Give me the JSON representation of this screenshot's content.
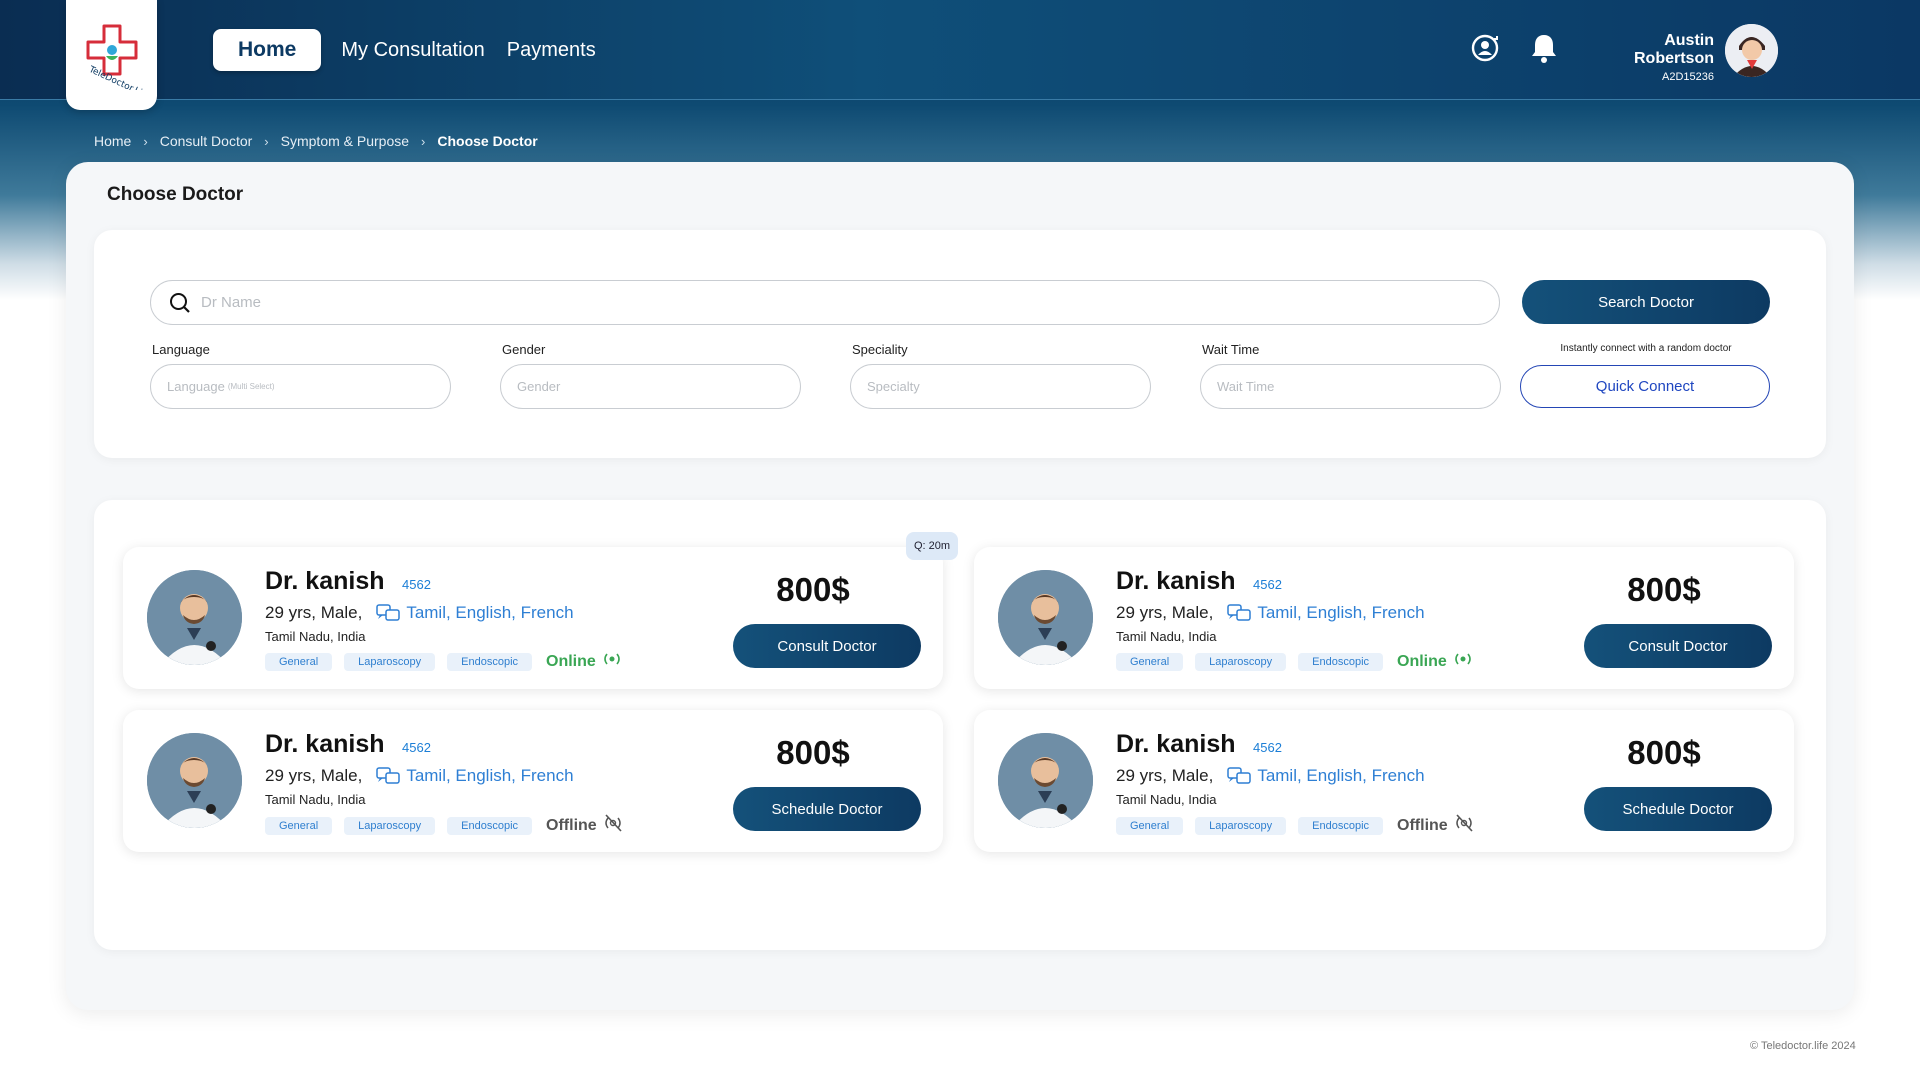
{
  "brand": {
    "logo_text": "TeleDoctor.Life"
  },
  "nav": {
    "home": "Home",
    "consultation": "My Consultation",
    "payments": "Payments"
  },
  "user": {
    "name": "Austin Robertson",
    "id": "A2D15236"
  },
  "icons": [
    "user-sync-icon",
    "bell-icon"
  ],
  "breadcrumb": [
    "Home",
    "Consult Doctor",
    "Symptom & Purpose",
    "Choose Doctor"
  ],
  "page": {
    "title": "Choose Doctor"
  },
  "search": {
    "placeholder": "Dr Name",
    "button": "Search Doctor"
  },
  "filters": {
    "language": {
      "label": "Language",
      "placeholder": "Language",
      "sub": "(Multi Select)"
    },
    "gender": {
      "label": "Gender",
      "placeholder": "Gender"
    },
    "speciality": {
      "label": "Speciality",
      "placeholder": "Specialty"
    },
    "wait_time": {
      "label": "Wait Time",
      "placeholder": "Wait Time"
    }
  },
  "quick_connect": {
    "note": "Instantly connect with a random doctor",
    "button": "Quick Connect"
  },
  "queue_badge": "Q: 20m",
  "doctors": [
    {
      "name": "Dr. kanish",
      "code": "4562",
      "meta": "29 yrs, Male,",
      "languages": "Tamil, English, French",
      "location": "Tamil Nadu, India",
      "tags": [
        "General",
        "Laparoscopy",
        "Endoscopic"
      ],
      "status": "Online",
      "price": "800$",
      "action": "Consult Doctor"
    },
    {
      "name": "Dr. kanish",
      "code": "4562",
      "meta": "29 yrs, Male,",
      "languages": "Tamil, English, French",
      "location": "Tamil Nadu, India",
      "tags": [
        "General",
        "Laparoscopy",
        "Endoscopic"
      ],
      "status": "Online",
      "price": "800$",
      "action": "Consult Doctor"
    },
    {
      "name": "Dr. kanish",
      "code": "4562",
      "meta": "29 yrs, Male,",
      "languages": "Tamil, English, French",
      "location": "Tamil Nadu, India",
      "tags": [
        "General",
        "Laparoscopy",
        "Endoscopic"
      ],
      "status": "Offline",
      "price": "800$",
      "action": "Schedule Doctor"
    },
    {
      "name": "Dr. kanish",
      "code": "4562",
      "meta": "29 yrs, Male,",
      "languages": "Tamil, English, French",
      "location": "Tamil Nadu, India",
      "tags": [
        "General",
        "Laparoscopy",
        "Endoscopic"
      ],
      "status": "Offline",
      "price": "800$",
      "action": "Schedule Doctor"
    }
  ],
  "footer": "© Teledoctor.life 2024",
  "colors": {
    "primary": "#0d3a62",
    "accent": "#1f46c0",
    "online": "#3aa654",
    "tag_bg": "#e9f1fa"
  }
}
